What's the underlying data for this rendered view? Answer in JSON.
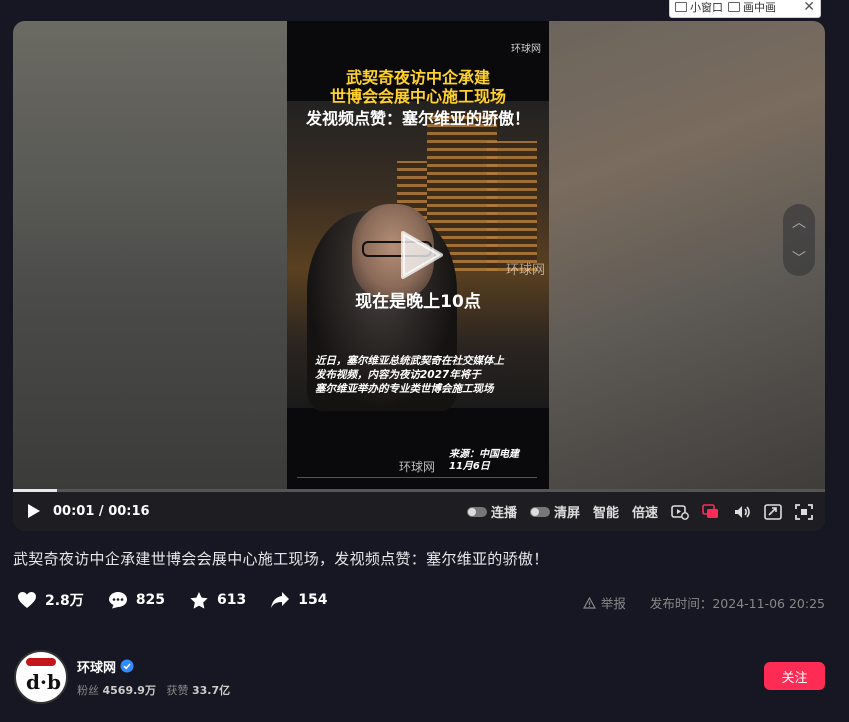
{
  "mini_bar": {
    "small_window": "小窗口",
    "pip": "画中画"
  },
  "video": {
    "headline_line1": "武契奇夜访中企承建",
    "headline_line2": "世博会会展中心施工现场",
    "headline_line3": "发视频点赞：塞尔维亚的骄傲！",
    "watermark_top": "环球网",
    "watermark_mid": "环球网",
    "subtitle": "现在是晚上10点",
    "desc_line1": "近日，塞尔维亚总统武契奇在社交媒体上",
    "desc_line2": "发布视频，内容为夜访2027年将于",
    "desc_line3": "塞尔维亚举办的专业类世博会施工现场",
    "bottom_watermark": "环球网",
    "source_line1": "来源：中国电建",
    "source_line2": "11月6日"
  },
  "controls": {
    "current_time": "00:01",
    "separator": "/",
    "duration": "00:16",
    "progress": 0.054,
    "continuous": "连播",
    "clear_screen": "清屏",
    "smart": "智能",
    "speed": "倍速"
  },
  "title": "武契奇夜访中企承建世博会会展中心施工现场，发视频点赞：塞尔维亚的骄傲！",
  "stats": {
    "likes": "2.8万",
    "comments": "825",
    "favorites": "613",
    "shares": "154"
  },
  "meta": {
    "report": "举报",
    "publish_label": "发布时间：",
    "publish_time": "2024-11-06 20:25"
  },
  "author": {
    "name": "环球网",
    "fans_label": "粉丝",
    "fans": "4569.9万",
    "likes_label": "获赞",
    "likes": "33.7亿",
    "follow": "关注"
  },
  "colors": {
    "accent": "#fe2c55",
    "headline_yellow": "#ffd12a",
    "verified": "#2f8bff"
  }
}
